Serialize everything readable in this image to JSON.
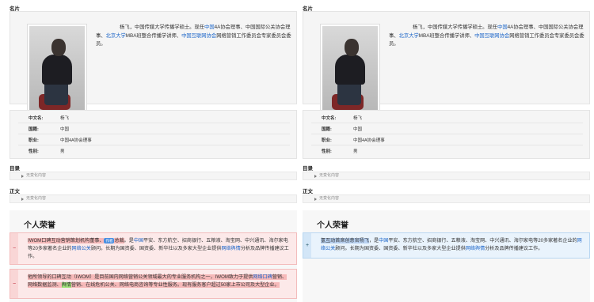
{
  "left": {
    "section_card": "名片",
    "intro_prefix": "杨飞，中国传媒大学传播学硕士。现任",
    "intro_link1": "中国",
    "intro_mid1": "4A协会理事、中国国际公关协会理事、",
    "intro_link2": "北京大学",
    "intro_mid2": "MBA班整合传播学讲师、",
    "intro_link3": "中国互联网协会",
    "intro_tail": "网络营销工作委员会专家委员会委员。",
    "info": [
      {
        "k": "中文名:",
        "v": "杨飞"
      },
      {
        "k": "国籍:",
        "v": "中国"
      },
      {
        "k": "职业:",
        "v": "中国4A协会理事"
      },
      {
        "k": "性别:",
        "v": "男"
      }
    ],
    "toc_label": "目录",
    "toc_collapse": "无变化内容",
    "body_label": "正文",
    "body_collapse": "无变化内容",
    "honor_title": "个人荣誉",
    "diff1_mark": "−",
    "diff1_hl1": "IWOM口碑互动营销策划机构董事、",
    "diff1_tag": "作者",
    "diff1_hl2": "总裁",
    "diff1_a": "。是",
    "diff1_link1": "中国",
    "diff1_b": "平安、东方航空、招商银行、五粮液、淘宝网、中兴通讯、海尔家电等20多家著名企业的",
    "diff1_link2": "网络公关",
    "diff1_c": "顾问。长期为国资委、国资委、新华社以及多家大型企业提供",
    "diff1_link3": "网络舆情",
    "diff1_d": "分析及品牌传播建议工作。",
    "diff2_mark": "−",
    "diff2_hl1": "他所领导的口碑互动（IWOM）是目前国内网络营销公关领域最大的专业服务机构之一，IWOM致力于提供",
    "diff2_link": "网络口碑",
    "diff2_hl2": "营销、网络数据监测、",
    "diff2_green": "舆情",
    "diff2_hl3": "营销、在线危机公关、网络电商咨询等专业性服务。现有服务客户超过50家上市公司及大型企业。"
  },
  "right": {
    "section_card": "名片",
    "intro_prefix": "杨飞，中国传媒大学传播学硕士。现任",
    "intro_link1": "中国",
    "intro_mid1": "4A协会理事、中国国际公关协会理事、",
    "intro_link2": "北京大学",
    "intro_mid2": "MBA班整合传播学讲师、",
    "intro_link3": "中国互联网协会",
    "intro_tail": "网络营销工作委员会专家委员会委员。",
    "info": [
      {
        "k": "中文名:",
        "v": "杨飞"
      },
      {
        "k": "国籍:",
        "v": "中国"
      },
      {
        "k": "职业:",
        "v": "中国4A协会理事"
      },
      {
        "k": "性别:",
        "v": "男"
      }
    ],
    "toc_label": "目录",
    "toc_collapse": "无变化内容",
    "body_label": "正文",
    "body_collapse": "无变化内容",
    "honor_title": "个人荣誉",
    "diff_mark": "+",
    "diff_hl1": "氢互动",
    "diff_hl2": "首席创意官杨飞",
    "diff_a": "，是",
    "diff_link1": "中国",
    "diff_b": "平安、东方航空、招商银行、五粮液、淘宝网、中兴通讯、海尔家电等20多家著名企业的",
    "diff_link2": "网络公关",
    "diff_c": "顾问。长期为国资委、国资委、新华社以及多家大型企业提供",
    "diff_link3": "网络舆情",
    "diff_d": "分析及品牌传播建议工作。"
  }
}
